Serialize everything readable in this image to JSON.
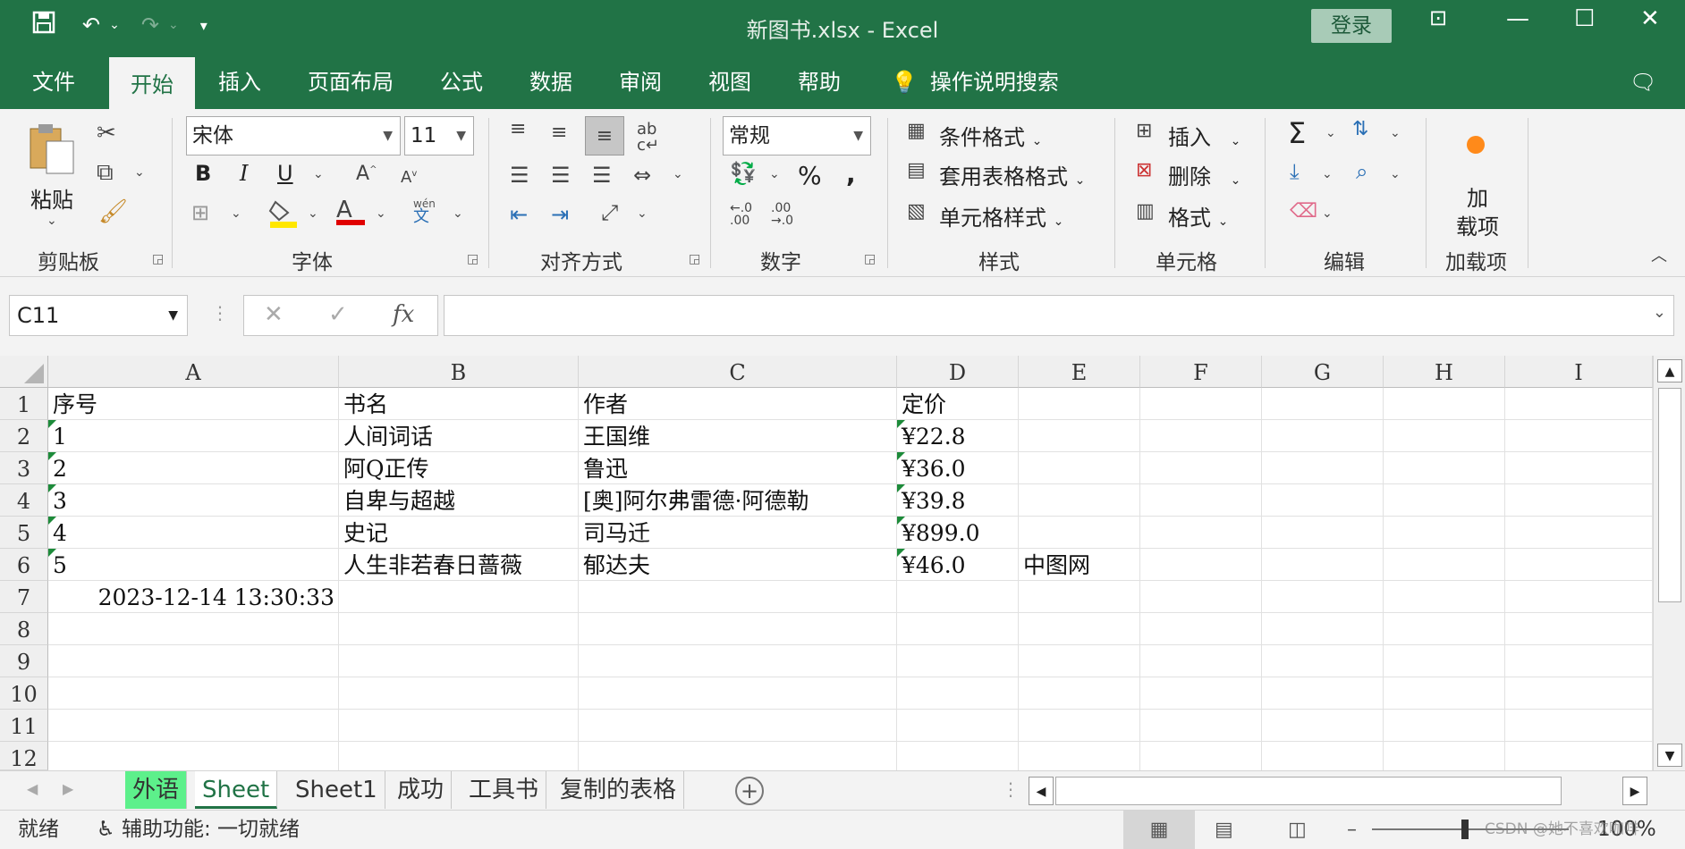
{
  "titlebar": {
    "title": "新图书.xlsx  -  Excel",
    "login": "登录",
    "icons": [
      "save-icon",
      "undo-icon",
      "redo-icon",
      "customize-qat-icon"
    ]
  },
  "tabs": [
    "文件",
    "开始",
    "插入",
    "页面布局",
    "公式",
    "数据",
    "审阅",
    "视图",
    "帮助"
  ],
  "active_tab": "开始",
  "tell_me": "操作说明搜索",
  "ribbon": {
    "clipboard": {
      "paste": "粘贴",
      "label": "剪贴板"
    },
    "font": {
      "name": "宋体",
      "size": "11",
      "label": "字体",
      "bold": "B",
      "italic": "I",
      "underline": "U",
      "font_color": "A",
      "wen": "wén",
      "wen2": "文"
    },
    "alignment": {
      "label": "对齐方式"
    },
    "number": {
      "format": "常规",
      "label": "数字",
      "percent": "%",
      "comma": ","
    },
    "styles": {
      "conditional": "条件格式",
      "table": "套用表格格式",
      "cell_styles": "单元格样式",
      "label": "样式"
    },
    "cells": {
      "insert": "插入",
      "delete": "删除",
      "format": "格式",
      "label": "单元格"
    },
    "editing": {
      "label": "编辑",
      "sigma": "Σ"
    },
    "addins": {
      "line1": "加",
      "line2": "载项",
      "label": "加载项"
    }
  },
  "formula_bar": {
    "name_box": "C11",
    "fx": "fx",
    "formula": ""
  },
  "grid": {
    "columns": [
      "A",
      "B",
      "C",
      "D",
      "E",
      "F",
      "G",
      "H",
      "I"
    ],
    "rows": [
      "1",
      "2",
      "3",
      "4",
      "5",
      "6",
      "7",
      "8",
      "9",
      "10",
      "11",
      "12"
    ],
    "cells": {
      "A1": "序号",
      "B1": "书名",
      "C1": "作者",
      "D1": "定价",
      "A2": "1",
      "B2": "人间词话",
      "C2": "王国维",
      "D2": "¥22.8",
      "A3": "2",
      "B3": "阿Q正传",
      "C3": "鲁迅",
      "D3": "¥36.0",
      "A4": "3",
      "B4": "自卑与超越",
      "C4": "[奥]阿尔弗雷德·阿德勒",
      "D4": "¥39.8",
      "A5": "4",
      "B5": "史记",
      "C5": "司马迁",
      "D5": "¥899.0",
      "A6": "5",
      "B6": "人生非若春日蔷薇",
      "C6": "郁达夫",
      "D6": "¥46.0",
      "E6": "中图网",
      "A7": "2023-12-14 13:30:33"
    }
  },
  "sheets": [
    "外语",
    "Sheet",
    "Sheet1",
    "成功",
    "工具书",
    "复制的表格"
  ],
  "active_sheet": "Sheet",
  "status": {
    "ready": "就绪",
    "accessibility": "辅助功能: 一切就绪",
    "zoom": "100%",
    "watermark": "CSDN @她不喜欢咖啡"
  },
  "colors": {
    "brand": "#217346",
    "highlight_tab": "#5df08b",
    "error_triangle": "#1d8b3a"
  }
}
